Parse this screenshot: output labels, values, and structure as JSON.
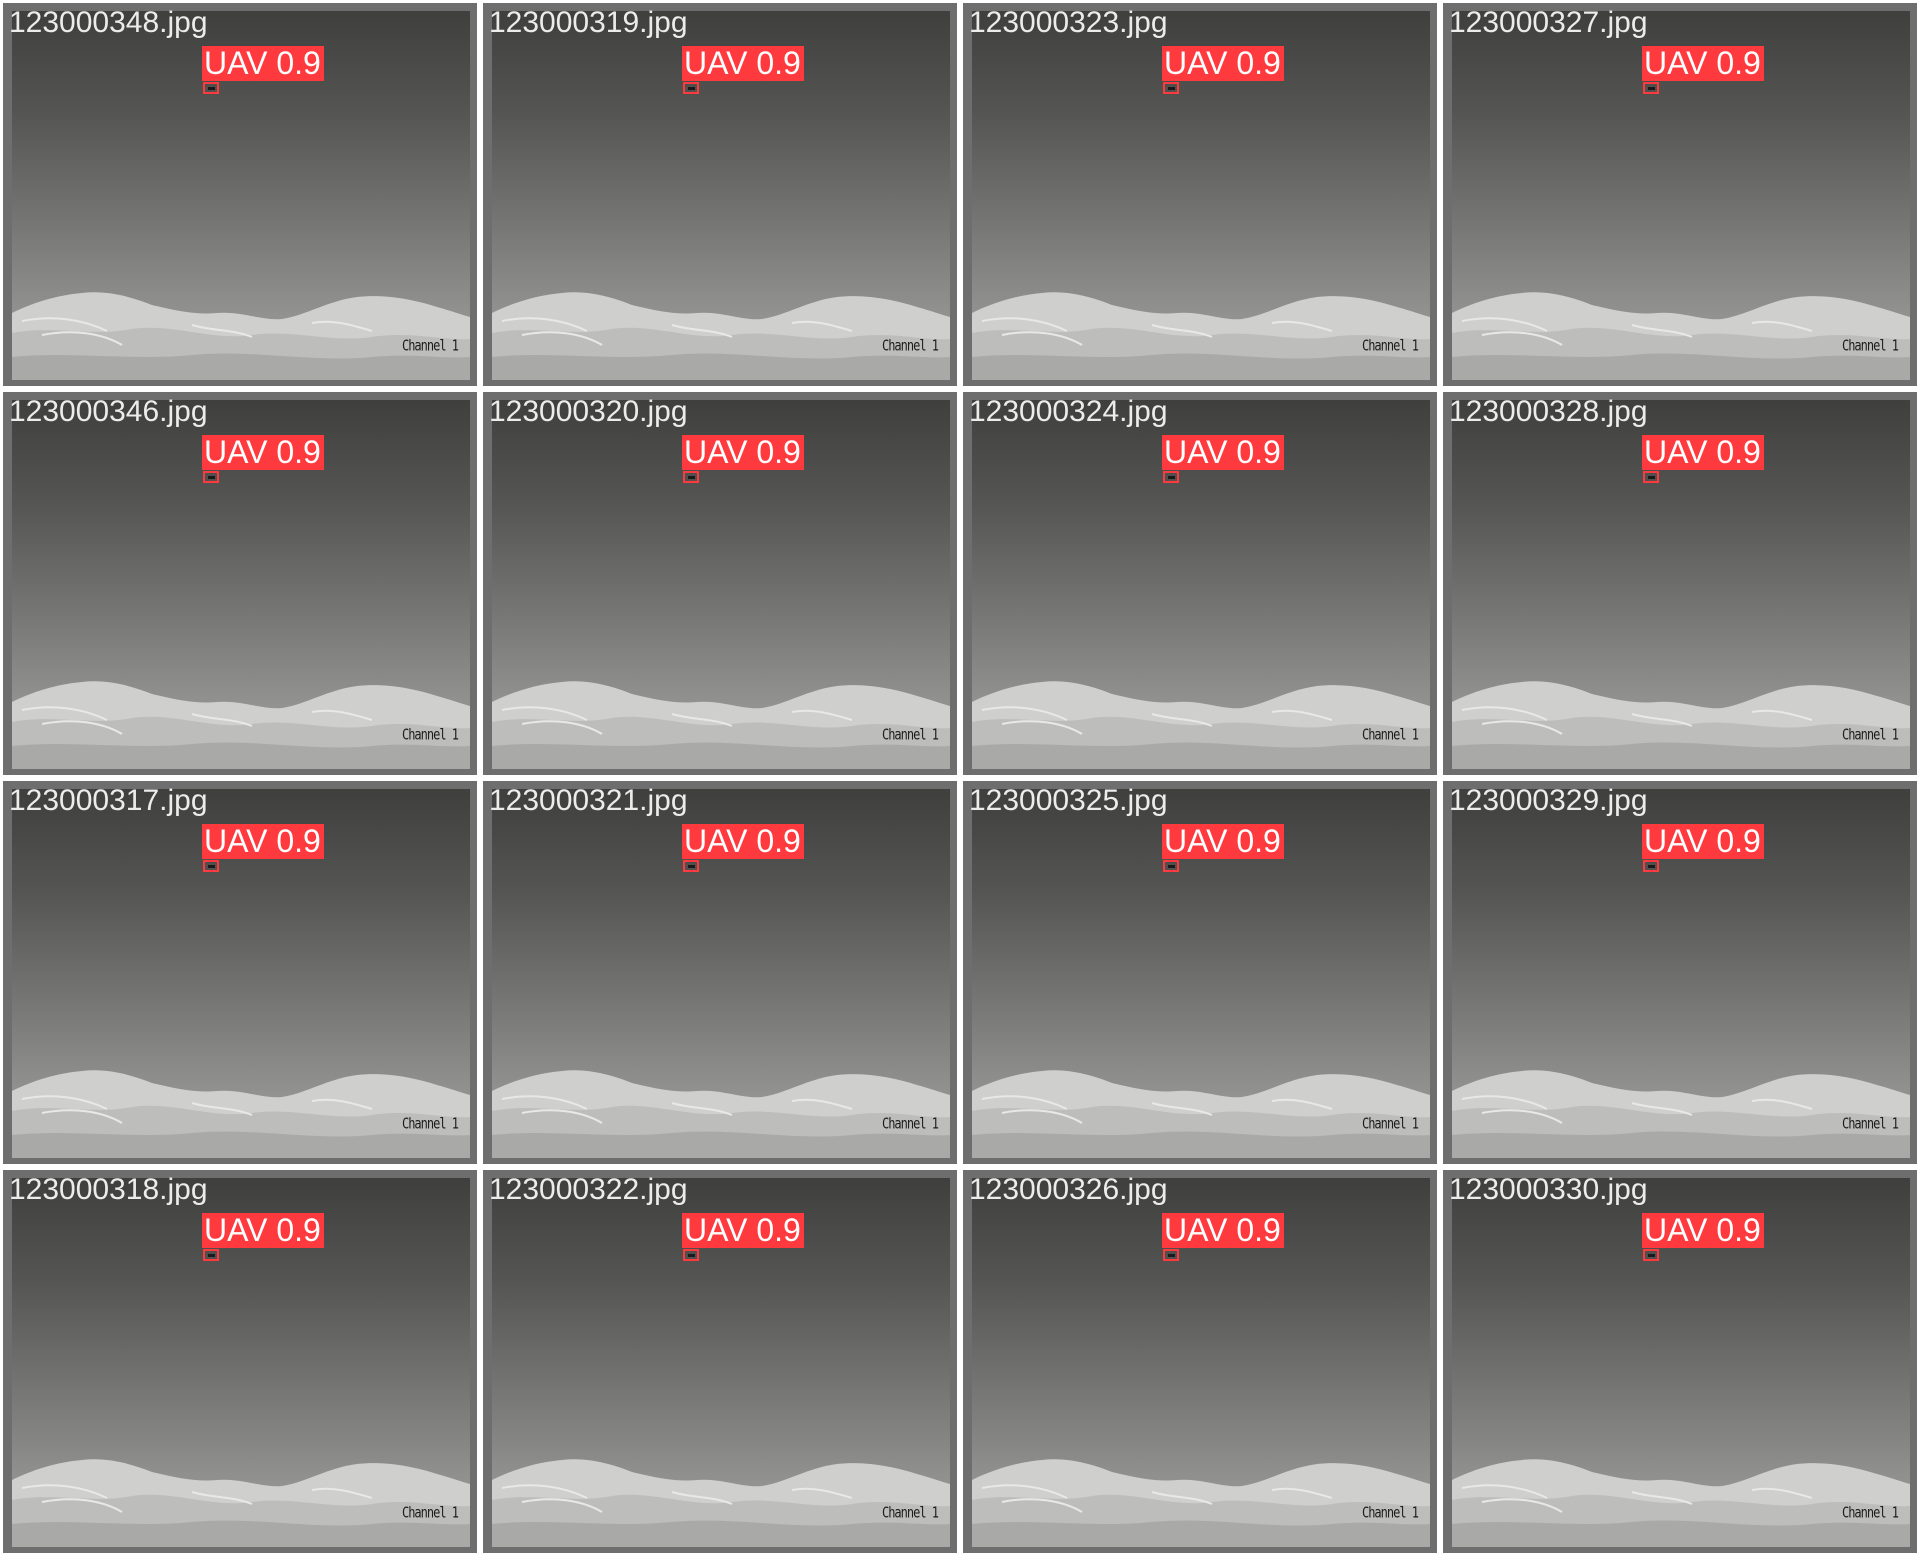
{
  "detection_color": "#ff3a3f",
  "tiles": [
    {
      "filename": "123000348.jpg",
      "detection": "UAV 0.9",
      "watermark": "Channel 1"
    },
    {
      "filename": "123000319.jpg",
      "detection": "UAV 0.9",
      "watermark": "Channel 1"
    },
    {
      "filename": "123000323.jpg",
      "detection": "UAV 0.9",
      "watermark": "Channel 1"
    },
    {
      "filename": "123000327.jpg",
      "detection": "UAV 0.9",
      "watermark": "Channel 1"
    },
    {
      "filename": "123000346.jpg",
      "detection": "UAV 0.9",
      "watermark": "Channel 1"
    },
    {
      "filename": "123000320.jpg",
      "detection": "UAV 0.9",
      "watermark": "Channel 1"
    },
    {
      "filename": "123000324.jpg",
      "detection": "UAV 0.9",
      "watermark": "Channel 1"
    },
    {
      "filename": "123000328.jpg",
      "detection": "UAV 0.9",
      "watermark": "Channel 1"
    },
    {
      "filename": "123000317.jpg",
      "detection": "UAV 0.9",
      "watermark": "Channel 1"
    },
    {
      "filename": "123000321.jpg",
      "detection": "UAV 0.9",
      "watermark": "Channel 1"
    },
    {
      "filename": "123000325.jpg",
      "detection": "UAV 0.9",
      "watermark": "Channel 1"
    },
    {
      "filename": "123000329.jpg",
      "detection": "UAV 0.9",
      "watermark": "Channel 1"
    },
    {
      "filename": "123000318.jpg",
      "detection": "UAV 0.9",
      "watermark": "Channel 1"
    },
    {
      "filename": "123000322.jpg",
      "detection": "UAV 0.9",
      "watermark": "Channel 1"
    },
    {
      "filename": "123000326.jpg",
      "detection": "UAV 0.9",
      "watermark": "Channel 1"
    },
    {
      "filename": "123000330.jpg",
      "detection": "UAV 0.9",
      "watermark": "Channel 1"
    }
  ]
}
